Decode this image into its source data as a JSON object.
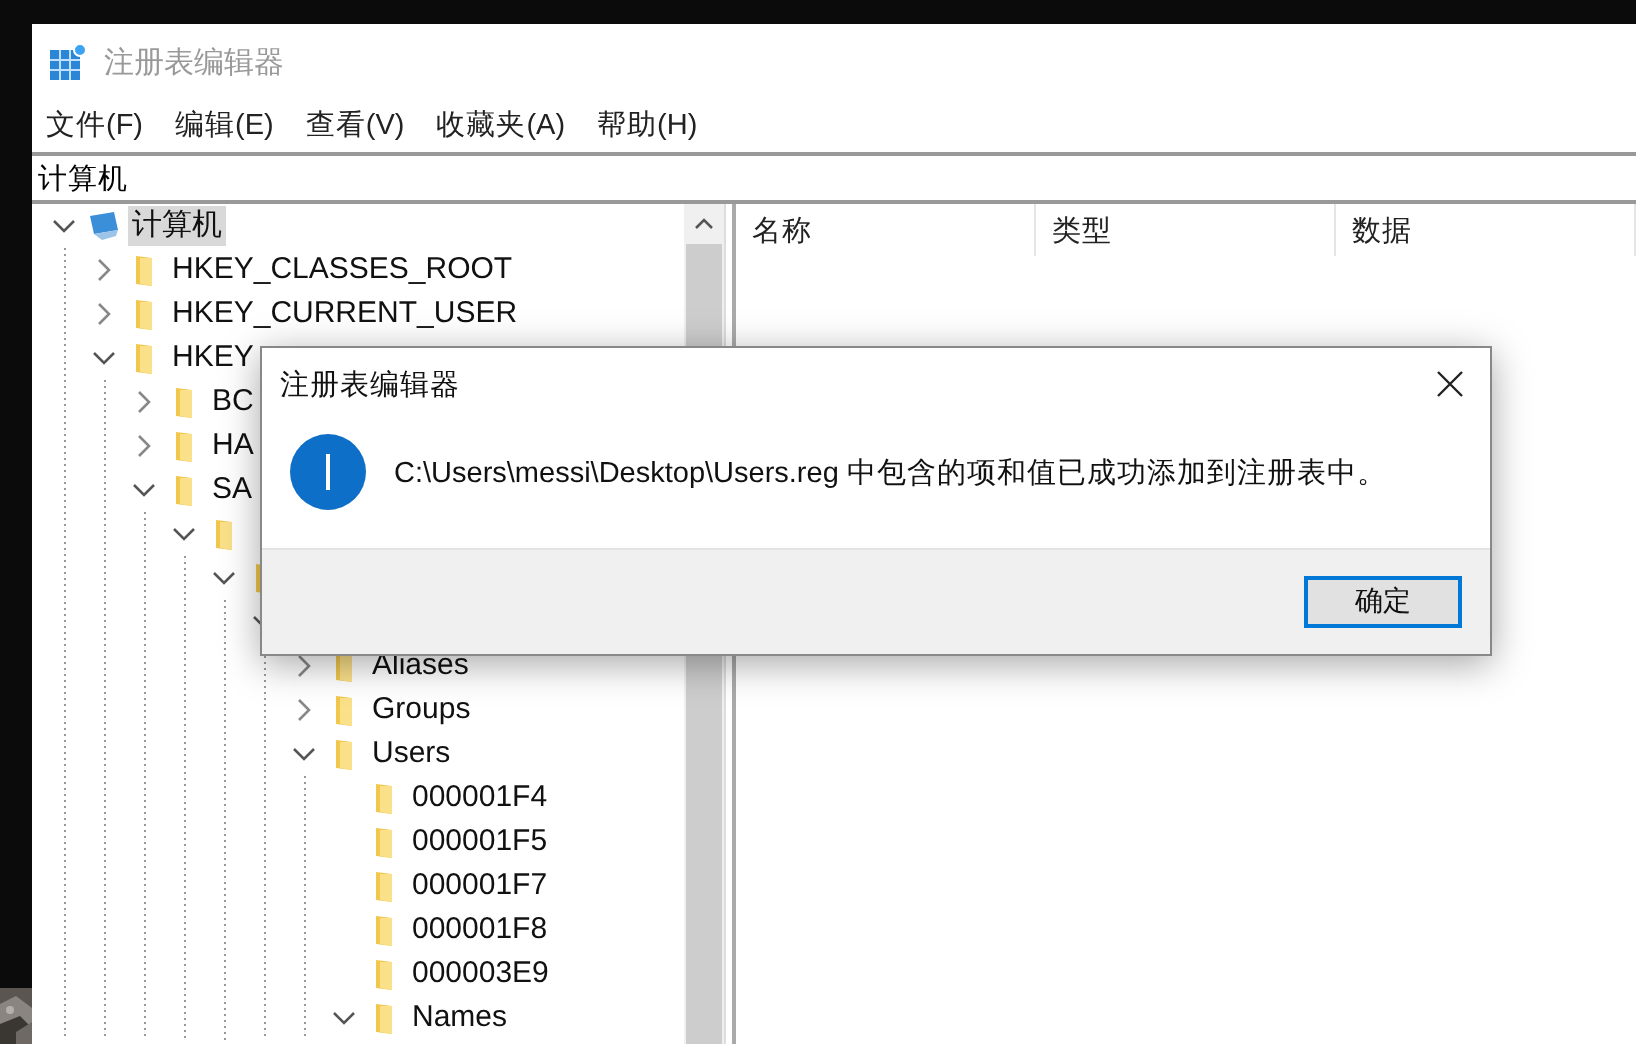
{
  "window": {
    "title": "注册表编辑器"
  },
  "menu": [
    "文件(F)",
    "编辑(E)",
    "查看(V)",
    "收藏夹(A)",
    "帮助(H)"
  ],
  "address": "计算机",
  "tree": [
    {
      "label": "计算机",
      "kind": "computer",
      "expanded": true,
      "selected": true,
      "children": [
        {
          "label": "HKEY_CLASSES_ROOT",
          "kind": "branch",
          "expanded": false,
          "selected": false
        },
        {
          "label": "HKEY_CURRENT_USER",
          "kind": "branch",
          "expanded": false,
          "selected": false
        },
        {
          "label": "HKEY",
          "kind": "branch",
          "expanded": true,
          "selected": false,
          "children": [
            {
              "label": "BC",
              "kind": "branch",
              "expanded": false,
              "selected": false
            },
            {
              "label": "HA",
              "kind": "branch",
              "expanded": false,
              "selected": false
            },
            {
              "label": "SA",
              "kind": "branch",
              "expanded": true,
              "selected": false,
              "children": [
                {
                  "kind": "branch",
                  "expanded": true,
                  "children": [
                    {
                      "kind": "branch",
                      "expanded": true,
                      "children": [
                        {
                          "kind": "stub",
                          "expanded": true,
                          "children": [
                            {
                              "label": "Aliases",
                              "kind": "branch",
                              "expanded": false,
                              "selected": false
                            },
                            {
                              "label": "Groups",
                              "kind": "branch",
                              "expanded": false,
                              "selected": false
                            },
                            {
                              "label": "Users",
                              "kind": "branch",
                              "expanded": true,
                              "selected": false,
                              "children": [
                                {
                                  "label": "000001F4",
                                  "kind": "leaf",
                                  "selected": false
                                },
                                {
                                  "label": "000001F5",
                                  "kind": "leaf",
                                  "selected": false
                                },
                                {
                                  "label": "000001F7",
                                  "kind": "leaf",
                                  "selected": false
                                },
                                {
                                  "label": "000001F8",
                                  "kind": "leaf",
                                  "selected": false
                                },
                                {
                                  "label": "000003E9",
                                  "kind": "leaf",
                                  "selected": false
                                },
                                {
                                  "label": "Names",
                                  "kind": "branch",
                                  "expanded": true,
                                  "selected": false
                                }
                              ]
                            }
                          ]
                        }
                      ]
                    }
                  ]
                }
              ]
            }
          ]
        }
      ]
    }
  ],
  "columns": [
    "名称",
    "类型",
    "数据"
  ],
  "dialog": {
    "title": "注册表编辑器",
    "kind": "info",
    "message": "C:\\Users\\messi\\Desktop\\Users.reg 中包含的项和值已成功添加到注册表中。",
    "buttons": [
      {
        "label": "确定",
        "default": true
      }
    ]
  }
}
